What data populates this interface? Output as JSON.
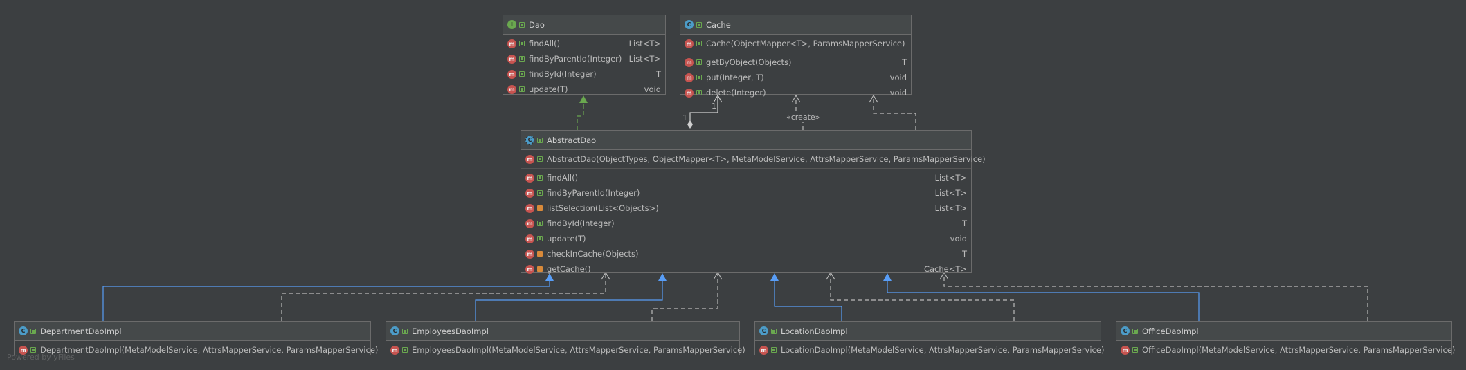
{
  "diagram": {
    "dao": {
      "badge": "I",
      "name": "Dao",
      "methods": [
        {
          "badge": "m",
          "name": "findAll()",
          "type": "List<T>"
        },
        {
          "badge": "m",
          "name": "findByParentId(Integer)",
          "type": "List<T>"
        },
        {
          "badge": "m",
          "name": "findById(Integer)",
          "type": "T"
        },
        {
          "badge": "m",
          "name": "update(T)",
          "type": "void"
        }
      ]
    },
    "cache": {
      "badge": "C",
      "name": "Cache",
      "constructor": "Cache(ObjectMapper<T>, ParamsMapperService)",
      "methods": [
        {
          "badge": "m",
          "name": "getByObject(Objects)",
          "type": "T"
        },
        {
          "badge": "m",
          "name": "put(Integer, T)",
          "type": "void"
        },
        {
          "badge": "m",
          "name": "delete(Integer)",
          "type": "void"
        }
      ]
    },
    "abstract_dao": {
      "badge": "C",
      "name": "AbstractDao",
      "constructor": "AbstractDao(ObjectTypes, ObjectMapper<T>, MetaModelService, AttrsMapperService, ParamsMapperService)",
      "methods": [
        {
          "badge": "m",
          "name": "findAll()",
          "type": "List<T>"
        },
        {
          "badge": "m",
          "name": "findByParentId(Integer)",
          "type": "List<T>"
        },
        {
          "badge": "m",
          "name": "listSelection(List<Objects>)",
          "type": "List<T>"
        },
        {
          "badge": "m",
          "name": "findById(Integer)",
          "type": "T"
        },
        {
          "badge": "m",
          "name": "update(T)",
          "type": "void"
        },
        {
          "badge": "m",
          "name": "checkInCache(Objects)",
          "type": "T"
        },
        {
          "badge": "m",
          "name": "getCache()",
          "type": "Cache<T>"
        }
      ]
    },
    "impls": [
      {
        "badge": "C",
        "name": "DepartmentDaoImpl",
        "constructor": "DepartmentDaoImpl(MetaModelService, AttrsMapperService, ParamsMapperService)"
      },
      {
        "badge": "C",
        "name": "EmployeesDaoImpl",
        "constructor": "EmployeesDaoImpl(MetaModelService, AttrsMapperService, ParamsMapperService)"
      },
      {
        "badge": "C",
        "name": "LocationDaoImpl",
        "constructor": "LocationDaoImpl(MetaModelService, AttrsMapperService, ParamsMapperService)"
      },
      {
        "badge": "C",
        "name": "OfficeDaoImpl",
        "constructor": "OfficeDaoImpl(MetaModelService, AttrsMapperService, ParamsMapperService)"
      }
    ],
    "edge_labels": {
      "create": "«create»",
      "mult_source": "1",
      "mult_target": "1"
    },
    "footer": "Powered by yFiles"
  },
  "colors": {
    "background": "#3c3f41",
    "border": "#6b6b6b",
    "inherit_line": "#589df6",
    "implements_line": "#6aa84f",
    "dependency_line": "#bbbbbb"
  }
}
